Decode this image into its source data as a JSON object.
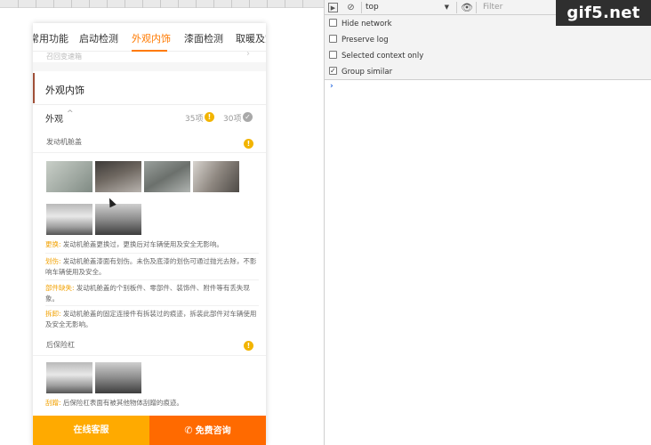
{
  "mobile": {
    "tabs": [
      "常用功能",
      "启动检测",
      "外观内饰",
      "漆面检测",
      "取暖及空"
    ],
    "active_tab_index": 2,
    "faded_row_text": "召回变速箱",
    "section_title": "外观内饰",
    "summary": {
      "label": "外观",
      "count_warn": "35项",
      "count_ok": "30项"
    },
    "items": [
      {
        "name": "发动机舱盖",
        "notes": [
          {
            "key": "更换:",
            "text": "发动机舱盖更换过，更换后对车辆使用及安全无影响。"
          },
          {
            "key": "划伤:",
            "text": "发动机舱盖漆面有划伤。未伤及底漆的划伤可通过抛光去除，不影响车辆使用及安全。"
          },
          {
            "key": "部件缺失:",
            "text": "发动机舱盖的个别板件、零部件、装饰件、附件等有丢失现象。"
          },
          {
            "key": "拆卸:",
            "text": "发动机舱盖的固定连接件有拆装过的痕迹，拆装此部件对车辆使用及安全无影响。"
          }
        ]
      },
      {
        "name": "后保险杠",
        "notes": [
          {
            "key": "刮蹭:",
            "text": "后保险杠表面有被其他物体刮蹭的痕迹。"
          }
        ]
      }
    ],
    "buttons": {
      "online": "在线客服",
      "consult": "免费咨询"
    }
  },
  "devtools": {
    "context": "top",
    "filter_placeholder": "Filter",
    "options": [
      {
        "label": "Hide network",
        "checked": false
      },
      {
        "label": "Preserve log",
        "checked": false
      },
      {
        "label": "Selected context only",
        "checked": false
      },
      {
        "label": "Group similar",
        "checked": true
      }
    ],
    "prompt": "›"
  },
  "watermark": "gif5.net",
  "colors": {
    "accent_orange": "#ff7a00",
    "button_yellow": "#ffaa00",
    "button_orange": "#ff6a00",
    "warn_badge": "#f2b400"
  }
}
